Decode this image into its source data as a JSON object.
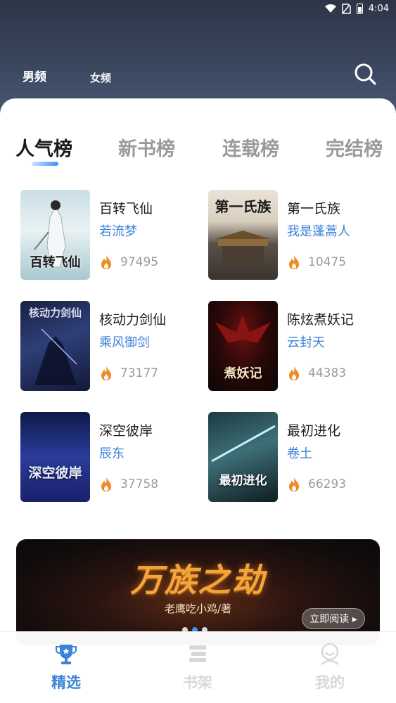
{
  "status_bar": {
    "time": "4:04"
  },
  "header": {
    "channels": [
      {
        "label": "男频",
        "active": true
      },
      {
        "label": "女频",
        "active": false
      }
    ]
  },
  "rank_tabs": [
    {
      "label": "人气榜",
      "active": true
    },
    {
      "label": "新书榜",
      "active": false
    },
    {
      "label": "连载榜",
      "active": false
    },
    {
      "label": "完结榜",
      "active": false
    }
  ],
  "books": [
    {
      "title": "百转飞仙",
      "author": "若流梦",
      "heat": "97495",
      "cover_text": "百转飞仙"
    },
    {
      "title": "第一氏族",
      "author": "我是蓬蒿人",
      "heat": "10475",
      "cover_text": "第一氏族"
    },
    {
      "title": "核动力剑仙",
      "author": "乘风御剑",
      "heat": "73177",
      "cover_text": "核动力剑仙"
    },
    {
      "title": "陈炫煮妖记",
      "author": "云封天",
      "heat": "44383",
      "cover_text": "煮妖记"
    },
    {
      "title": "深空彼岸",
      "author": "辰东",
      "heat": "37758",
      "cover_text": "深空彼岸"
    },
    {
      "title": "最初进化",
      "author": "卷土",
      "heat": "66293",
      "cover_text": "最初进化"
    }
  ],
  "banner": {
    "title": "万族之劫",
    "author": "老鹰吃小鸡/著",
    "button": "立即阅读 ▸"
  },
  "bottom_nav": [
    {
      "label": "精选",
      "icon": "trophy-icon",
      "active": true
    },
    {
      "label": "书架",
      "icon": "bookshelf-icon",
      "active": false
    },
    {
      "label": "我的",
      "icon": "profile-icon",
      "active": false
    }
  ],
  "colors": {
    "accent": "#3b82d8",
    "header_bg": "#2d3446",
    "heat_flame": "#f08a24"
  }
}
